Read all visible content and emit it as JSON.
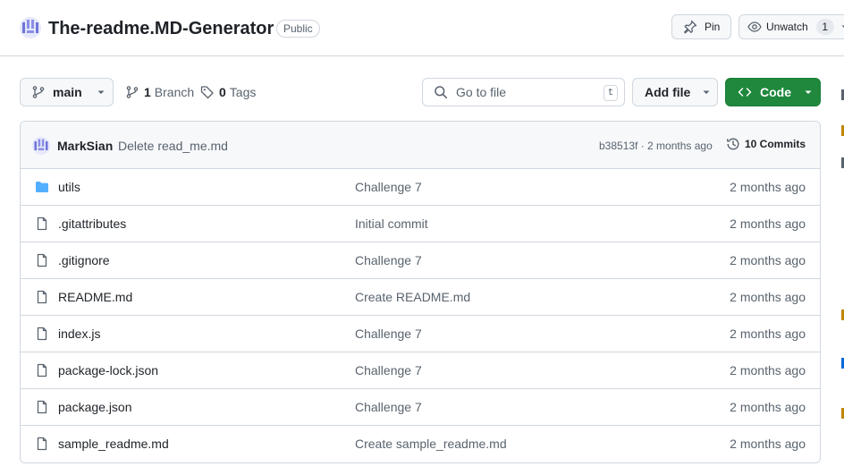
{
  "repo": {
    "name": "The-readme.MD-Generator",
    "visibility": "Public"
  },
  "header_actions": {
    "pin_label": "Pin",
    "unwatch_label": "Unwatch",
    "watch_count": "1"
  },
  "toolbar": {
    "branch": "main",
    "branch_count": "1",
    "branch_word": "Branch",
    "tag_count": "0",
    "tag_word": "Tags",
    "search_placeholder": "Go to file",
    "search_shortcut": "t",
    "add_file_label": "Add file",
    "code_label": "Code"
  },
  "latest_commit": {
    "author": "MarkSian",
    "message": "Delete read_me.md",
    "sha_age": "b38513f · 2 months ago",
    "commits_label": "10 Commits"
  },
  "files": [
    {
      "name": "utils",
      "type": "folder",
      "commit": "Challenge 7",
      "age": "2 months ago"
    },
    {
      "name": ".gitattributes",
      "type": "file",
      "commit": "Initial commit",
      "age": "2 months ago"
    },
    {
      "name": ".gitignore",
      "type": "file",
      "commit": "Challenge 7",
      "age": "2 months ago"
    },
    {
      "name": "README.md",
      "type": "file",
      "commit": "Create README.md",
      "age": "2 months ago"
    },
    {
      "name": "index.js",
      "type": "file",
      "commit": "Challenge 7",
      "age": "2 months ago"
    },
    {
      "name": "package-lock.json",
      "type": "file",
      "commit": "Challenge 7",
      "age": "2 months ago"
    },
    {
      "name": "package.json",
      "type": "file",
      "commit": "Challenge 7",
      "age": "2 months ago"
    },
    {
      "name": "sample_readme.md",
      "type": "file",
      "commit": "Create sample_readme.md",
      "age": "2 months ago"
    }
  ],
  "colors": {
    "primary_green": "#1f883d",
    "folder_blue": "#54aeff",
    "muted_text": "#59636e",
    "border": "#d0d7de"
  },
  "icons": [
    "pin-icon",
    "eye-icon",
    "branch-icon",
    "tag-icon",
    "search-icon",
    "code-icon",
    "history-icon",
    "folder-icon",
    "file-icon",
    "caret-down-icon"
  ]
}
